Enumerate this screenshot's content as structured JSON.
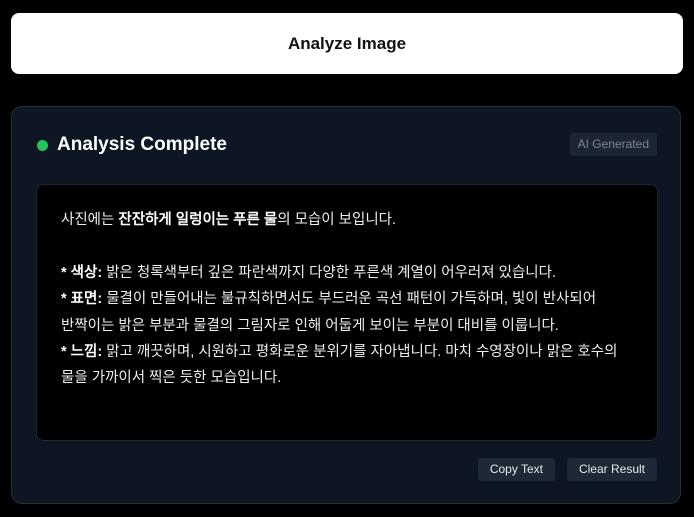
{
  "analyze_button": {
    "label": "Analyze Image"
  },
  "result_card": {
    "title": "Analysis Complete",
    "badge": "AI Generated",
    "status_color": "#22c55e",
    "intro": {
      "before": "사진에는 ",
      "emphasis": "잔잔하게 일렁이는 푸른 물",
      "after": "의 모습이 보입니다."
    },
    "points": [
      {
        "label": "* 색상:",
        "text": " 밝은 청록색부터 깊은 파란색까지 다양한 푸른색 계열이 어우러져 있습니다."
      },
      {
        "label": "* 표면:",
        "text": " 물결이 만들어내는 불규칙하면서도 부드러운 곡선 패턴이 가득하며, 빛이 반사되어 반짝이는 밝은 부분과 물결의 그림자로 인해 어둡게 보이는 부분이 대비를 이룹니다."
      },
      {
        "label": "* 느낌:",
        "text": " 맑고 깨끗하며, 시원하고 평화로운 분위기를 자아냅니다. 마치 수영장이나 맑은 호수의 물을 가까이서 찍은 듯한 모습입니다."
      }
    ]
  },
  "actions": {
    "copy_label": "Copy Text",
    "clear_label": "Clear Result"
  }
}
